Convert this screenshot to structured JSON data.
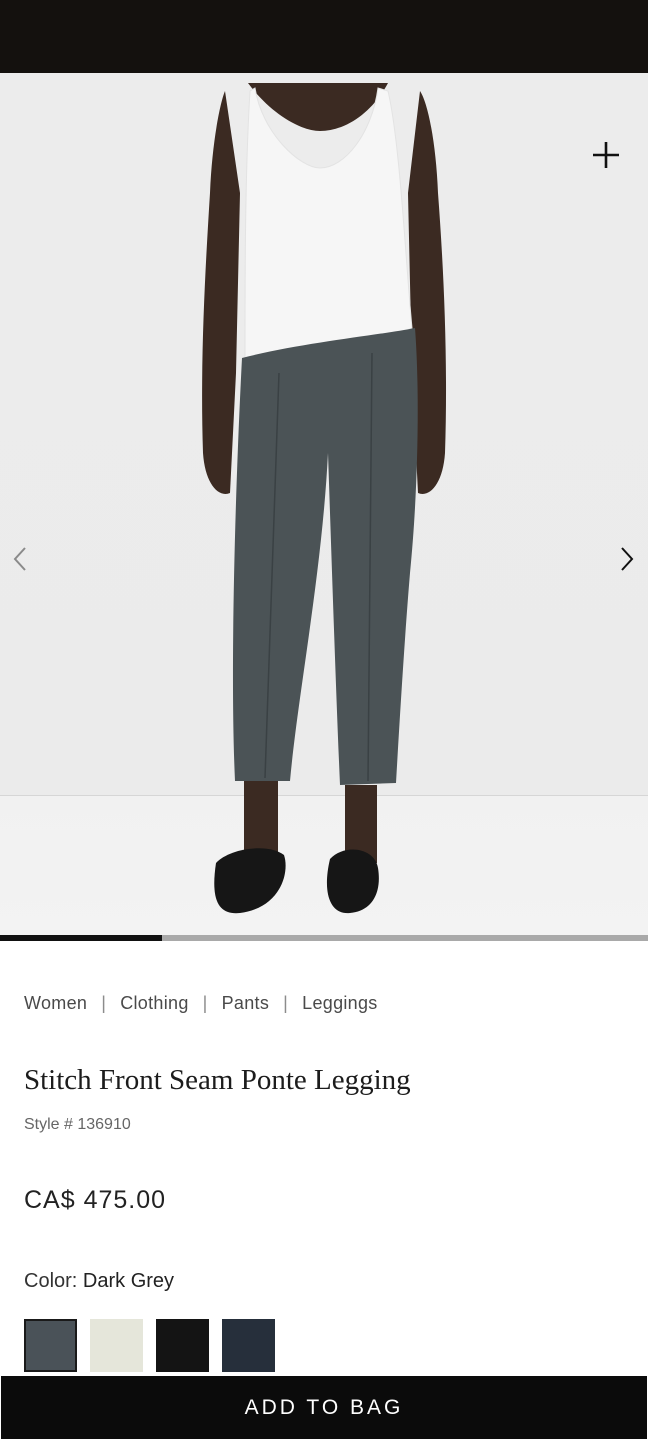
{
  "breadcrumb": [
    "Women",
    "Clothing",
    "Pants",
    "Leggings"
  ],
  "product": {
    "title": "Stitch Front Seam Ponte Legging",
    "style": "Style # 136910",
    "price": "CA$ 475.00",
    "color_label": "Color:",
    "color_value": "Dark Grey"
  },
  "swatches": [
    {
      "name": "Dark Grey",
      "color": "#4a5258",
      "selected": true
    },
    {
      "name": "Off White",
      "color": "#e5e6da",
      "selected": false
    },
    {
      "name": "Black",
      "color": "#141414",
      "selected": false
    },
    {
      "name": "Navy",
      "color": "#262f3b",
      "selected": false
    }
  ],
  "gallery": {
    "progress": 0.25
  },
  "cta": {
    "label": "ADD TO BAG"
  },
  "icons": {
    "zoom": "plus-icon",
    "prev": "chevron-left-icon",
    "next": "chevron-right-icon"
  }
}
